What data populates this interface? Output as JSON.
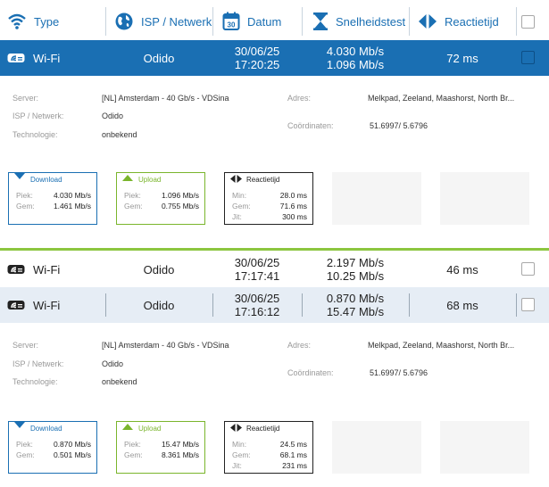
{
  "header": {
    "type_label": "Type",
    "isp_label": "ISP / Netwerk",
    "date_label": "Datum",
    "calendar_day": "30",
    "speed_label": "Snelheidstest",
    "latency_label": "Reactietijd"
  },
  "rows": [
    {
      "type": "Wi-Fi",
      "isp": "Odido",
      "date": "30/06/25",
      "time": "17:20:25",
      "down": "4.030 Mb/s",
      "up": "1.096 Mb/s",
      "latency": "72 ms"
    },
    {
      "type": "Wi-Fi",
      "isp": "Odido",
      "date": "30/06/25",
      "time": "17:17:41",
      "down": "2.197 Mb/s",
      "up": "10.25 Mb/s",
      "latency": "46 ms"
    },
    {
      "type": "Wi-Fi",
      "isp": "Odido",
      "date": "30/06/25",
      "time": "17:16:12",
      "down": "0.870 Mb/s",
      "up": "15.47 Mb/s",
      "latency": "68 ms"
    }
  ],
  "details": [
    {
      "labels": {
        "server": "Server:",
        "isp": "ISP / Netwerk:",
        "tech": "Technologie:",
        "address": "Adres:",
        "coords": "Coördinaten:"
      },
      "server": "[NL] Amsterdam - 40 Gb/s - VDSina",
      "isp": "Odido",
      "tech": "onbekend",
      "address": "Melkpad, Zeeland, Maashorst, North Br...",
      "coords": "51.6997/ 5.6796",
      "download": {
        "title": "Download",
        "peak_label": "Piek:",
        "peak": "4.030 Mb/s",
        "avg_label": "Gem:",
        "avg": "1.461 Mb/s"
      },
      "upload": {
        "title": "Upload",
        "peak_label": "Piek:",
        "peak": "1.096 Mb/s",
        "avg_label": "Gem:",
        "avg": "0.755 Mb/s"
      },
      "latency": {
        "title": "Reactietijd",
        "min_label": "Min:",
        "min": "28.0 ms",
        "avg_label": "Gem:",
        "avg": "71.6 ms",
        "jit_label": "Jit:",
        "jit": "300 ms"
      }
    },
    {
      "labels": {
        "server": "Server:",
        "isp": "ISP / Netwerk:",
        "tech": "Technologie:",
        "address": "Adres:",
        "coords": "Coördinaten:"
      },
      "server": "[NL] Amsterdam - 40 Gb/s - VDSina",
      "isp": "Odido",
      "tech": "onbekend",
      "address": "Melkpad, Zeeland, Maashorst, North Br...",
      "coords": "51.6997/ 5.6796",
      "download": {
        "title": "Download",
        "peak_label": "Piek:",
        "peak": "0.870 Mb/s",
        "avg_label": "Gem:",
        "avg": "0.501 Mb/s"
      },
      "upload": {
        "title": "Upload",
        "peak_label": "Piek:",
        "peak": "15.47 Mb/s",
        "avg_label": "Gem:",
        "avg": "8.361 Mb/s"
      },
      "latency": {
        "title": "Reactietijd",
        "min_label": "Min:",
        "min": "24.5 ms",
        "avg_label": "Gem:",
        "avg": "68.1 ms",
        "jit_label": "Jit:",
        "jit": "231 ms"
      }
    }
  ],
  "colors": {
    "accent": "#1a6fb3",
    "upload": "#7ab52c",
    "selected_row": "#1a6fb3",
    "alt_row": "#e6edf5"
  }
}
